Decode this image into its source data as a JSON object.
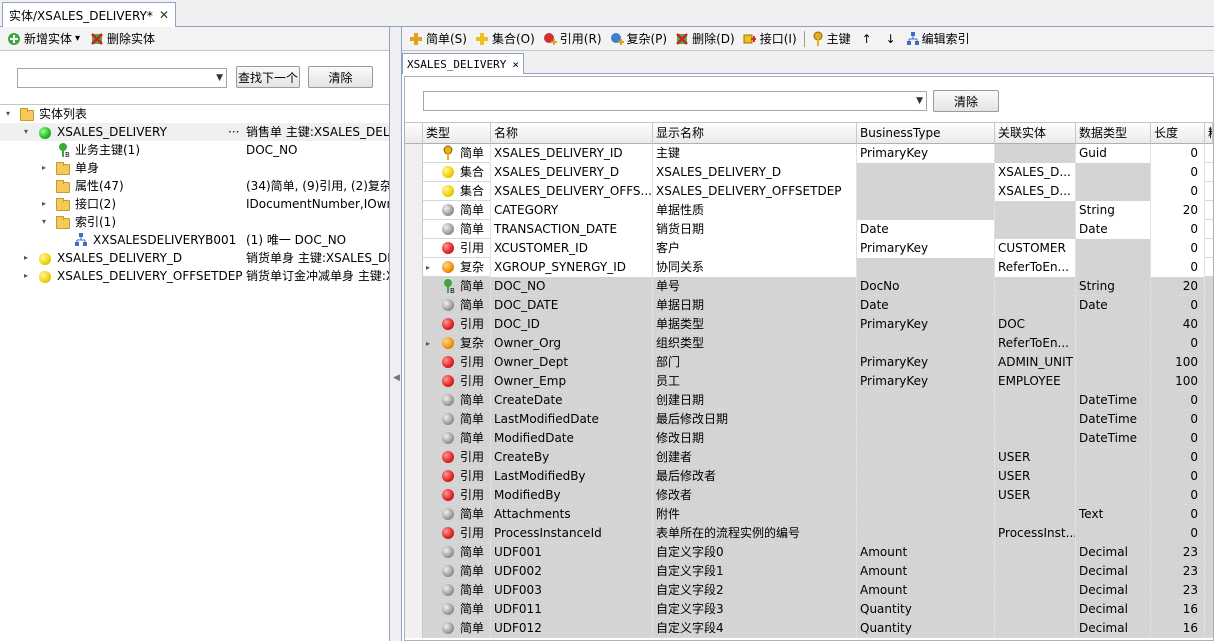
{
  "doc_tab": {
    "title": "实体/XSALES_DELIVERY*",
    "close": "✕"
  },
  "left_toolbar": {
    "add_entity": "新增实体",
    "dropdown": "▾",
    "delete_entity": "删除实体"
  },
  "left_search": {
    "value": "",
    "find_next": "查找下一个",
    "clear": "清除"
  },
  "tree": {
    "root": "实体列表",
    "items": [
      {
        "label": "XSALES_DELIVERY",
        "desc": "销售单 主键:XSALES_DELIVERY_ID",
        "ellipsis": "···"
      },
      {
        "label": "业务主键(1)",
        "desc": "DOC_NO"
      },
      {
        "label": "单身",
        "desc": ""
      },
      {
        "label": "属性(47)",
        "desc": "(34)简单, (9)引用, (2)复杂"
      },
      {
        "label": "接口(2)",
        "desc": "IDocumentNumber,IOwner"
      },
      {
        "label": "索引(1)",
        "desc": ""
      },
      {
        "label": "XXSALESDELIVERYB001",
        "desc": "(1) 唯一 DOC_NO"
      },
      {
        "label": "XSALES_DELIVERY_D",
        "desc": "销货单身 主键:XSALES_DELIVERY_D_ID"
      },
      {
        "label": "XSALES_DELIVERY_OFFSETDEP",
        "desc": "销货单订金冲减单身 主键:XSALES"
      }
    ]
  },
  "right_toolbar": {
    "simple": "简单(S)",
    "collection": "集合(O)",
    "reference": "引用(R)",
    "complex": "复杂(P)",
    "delete": "删除(D)",
    "interface": "接口(I)",
    "primary_key": "主键",
    "up": "↑",
    "down": "↓",
    "edit_index": "编辑索引"
  },
  "inner_tab": {
    "title": "XSALES_DELIVERY",
    "close": "×"
  },
  "grid_filter": {
    "value": "",
    "clear": "清除"
  },
  "grid": {
    "headers": [
      "类型",
      "名称",
      "显示名称",
      "BusinessType",
      "关联实体",
      "数据类型",
      "长度",
      "精度"
    ],
    "rows": [
      {
        "icon": "key",
        "type": "简单",
        "name": "XSALES_DELIVERY_ID",
        "display": "主键",
        "btype": "PrimaryKey",
        "entity": "",
        "dtype": "Guid",
        "length": "0"
      },
      {
        "icon": "yellow",
        "type": "集合",
        "name": "XSALES_DELIVERY_D",
        "display": "XSALES_DELIVERY_D",
        "btype": "",
        "entity": "XSALES_D...",
        "dtype": "",
        "length": "0"
      },
      {
        "icon": "yellow",
        "type": "集合",
        "name": "XSALES_DELIVERY_OFFS...",
        "display": "XSALES_DELIVERY_OFFSETDEP",
        "btype": "",
        "entity": "XSALES_D...",
        "dtype": "",
        "length": "0"
      },
      {
        "icon": "gray",
        "type": "简单",
        "name": "CATEGORY",
        "display": "单据性质",
        "btype": "",
        "entity": "",
        "dtype": "String",
        "length": "20"
      },
      {
        "icon": "gray",
        "type": "简单",
        "name": "TRANSACTION_DATE",
        "display": "销货日期",
        "btype": "Date",
        "entity": "",
        "dtype": "Date",
        "length": "0"
      },
      {
        "icon": "red",
        "type": "引用",
        "name": "XCUSTOMER_ID",
        "display": "客户",
        "btype": "PrimaryKey",
        "entity": "CUSTOMER",
        "dtype": "",
        "length": "0"
      },
      {
        "icon": "orange",
        "expand": "▸",
        "type": "复杂",
        "name": "XGROUP_SYNERGY_ID",
        "display": "协同关系",
        "btype": "",
        "entity": "ReferToEn...",
        "dtype": "",
        "length": "0"
      },
      {
        "icon": "greenkey",
        "type": "简单",
        "name": "DOC_NO",
        "display": "单号",
        "btype": "DocNo",
        "entity": "",
        "dtype": "String",
        "length": "20"
      },
      {
        "icon": "gray",
        "type": "简单",
        "name": "DOC_DATE",
        "display": "单据日期",
        "btype": "Date",
        "entity": "",
        "dtype": "Date",
        "length": "0"
      },
      {
        "icon": "red",
        "type": "引用",
        "name": "DOC_ID",
        "display": "单据类型",
        "btype": "PrimaryKey",
        "entity": "DOC",
        "dtype": "",
        "length": "40"
      },
      {
        "icon": "orange",
        "expand": "▸",
        "type": "复杂",
        "name": "Owner_Org",
        "display": "组织类型",
        "btype": "",
        "entity": "ReferToEn...",
        "dtype": "",
        "length": "0"
      },
      {
        "icon": "red",
        "type": "引用",
        "name": "Owner_Dept",
        "display": "部门",
        "btype": "PrimaryKey",
        "entity": "ADMIN_UNIT",
        "dtype": "",
        "length": "100"
      },
      {
        "icon": "red",
        "type": "引用",
        "name": "Owner_Emp",
        "display": "员工",
        "btype": "PrimaryKey",
        "entity": "EMPLOYEE",
        "dtype": "",
        "length": "100"
      },
      {
        "icon": "gray",
        "type": "简单",
        "name": "CreateDate",
        "display": "创建日期",
        "btype": "",
        "entity": "",
        "dtype": "DateTime",
        "length": "0"
      },
      {
        "icon": "gray",
        "type": "简单",
        "name": "LastModifiedDate",
        "display": "最后修改日期",
        "btype": "",
        "entity": "",
        "dtype": "DateTime",
        "length": "0"
      },
      {
        "icon": "gray",
        "type": "简单",
        "name": "ModifiedDate",
        "display": "修改日期",
        "btype": "",
        "entity": "",
        "dtype": "DateTime",
        "length": "0"
      },
      {
        "icon": "red",
        "type": "引用",
        "name": "CreateBy",
        "display": "创建者",
        "btype": "",
        "entity": "USER",
        "dtype": "",
        "length": "0"
      },
      {
        "icon": "red",
        "type": "引用",
        "name": "LastModifiedBy",
        "display": "最后修改者",
        "btype": "",
        "entity": "USER",
        "dtype": "",
        "length": "0"
      },
      {
        "icon": "red",
        "type": "引用",
        "name": "ModifiedBy",
        "display": "修改者",
        "btype": "",
        "entity": "USER",
        "dtype": "",
        "length": "0"
      },
      {
        "icon": "gray",
        "type": "简单",
        "name": "Attachments",
        "display": "附件",
        "btype": "",
        "entity": "",
        "dtype": "Text",
        "length": "0"
      },
      {
        "icon": "red",
        "type": "引用",
        "name": "ProcessInstanceId",
        "display": "表单所在的流程实例的编号",
        "btype": "",
        "entity": "ProcessInst...",
        "dtype": "",
        "length": "0"
      },
      {
        "icon": "gray",
        "type": "简单",
        "name": "UDF001",
        "display": "自定义字段0",
        "btype": "Amount",
        "entity": "",
        "dtype": "Decimal",
        "length": "23"
      },
      {
        "icon": "gray",
        "type": "简单",
        "name": "UDF002",
        "display": "自定义字段1",
        "btype": "Amount",
        "entity": "",
        "dtype": "Decimal",
        "length": "23"
      },
      {
        "icon": "gray",
        "type": "简单",
        "name": "UDF003",
        "display": "自定义字段2",
        "btype": "Amount",
        "entity": "",
        "dtype": "Decimal",
        "length": "23"
      },
      {
        "icon": "gray",
        "type": "简单",
        "name": "UDF011",
        "display": "自定义字段3",
        "btype": "Quantity",
        "entity": "",
        "dtype": "Decimal",
        "length": "16"
      },
      {
        "icon": "gray",
        "type": "简单",
        "name": "UDF012",
        "display": "自定义字段4",
        "btype": "Quantity",
        "entity": "",
        "dtype": "Decimal",
        "length": "16"
      }
    ]
  },
  "colors": {
    "accent_border": "#8ba3c4",
    "row_gray": "#d4d4d4",
    "selected_row": "#f0f0f0"
  }
}
